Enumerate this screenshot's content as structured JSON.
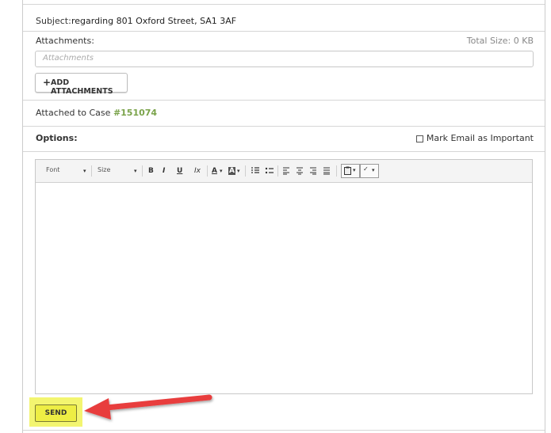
{
  "subject": {
    "label": "Subject:",
    "value": "regarding 801 Oxford Street, SA1 3AF"
  },
  "attachments": {
    "label": "Attachments:",
    "total_size": "Total Size:  0 KB",
    "placeholder": "Attachments",
    "add_button": "ADD ATTACHMENTS"
  },
  "case": {
    "label": "Attached to Case",
    "number": "#151074"
  },
  "options": {
    "label": "Options:",
    "important_label": "Mark Email as Important"
  },
  "toolbar": {
    "font": "Font",
    "size": "Size",
    "bold": "B",
    "italic": "I",
    "underline": "U",
    "clear_format": "Ix",
    "text_color": "A",
    "bg_color": "A"
  },
  "send_label": "SEND",
  "colors": {
    "case_number": "#7aa34a",
    "highlight": "#f3f570",
    "arrow": "#e83c3c"
  }
}
